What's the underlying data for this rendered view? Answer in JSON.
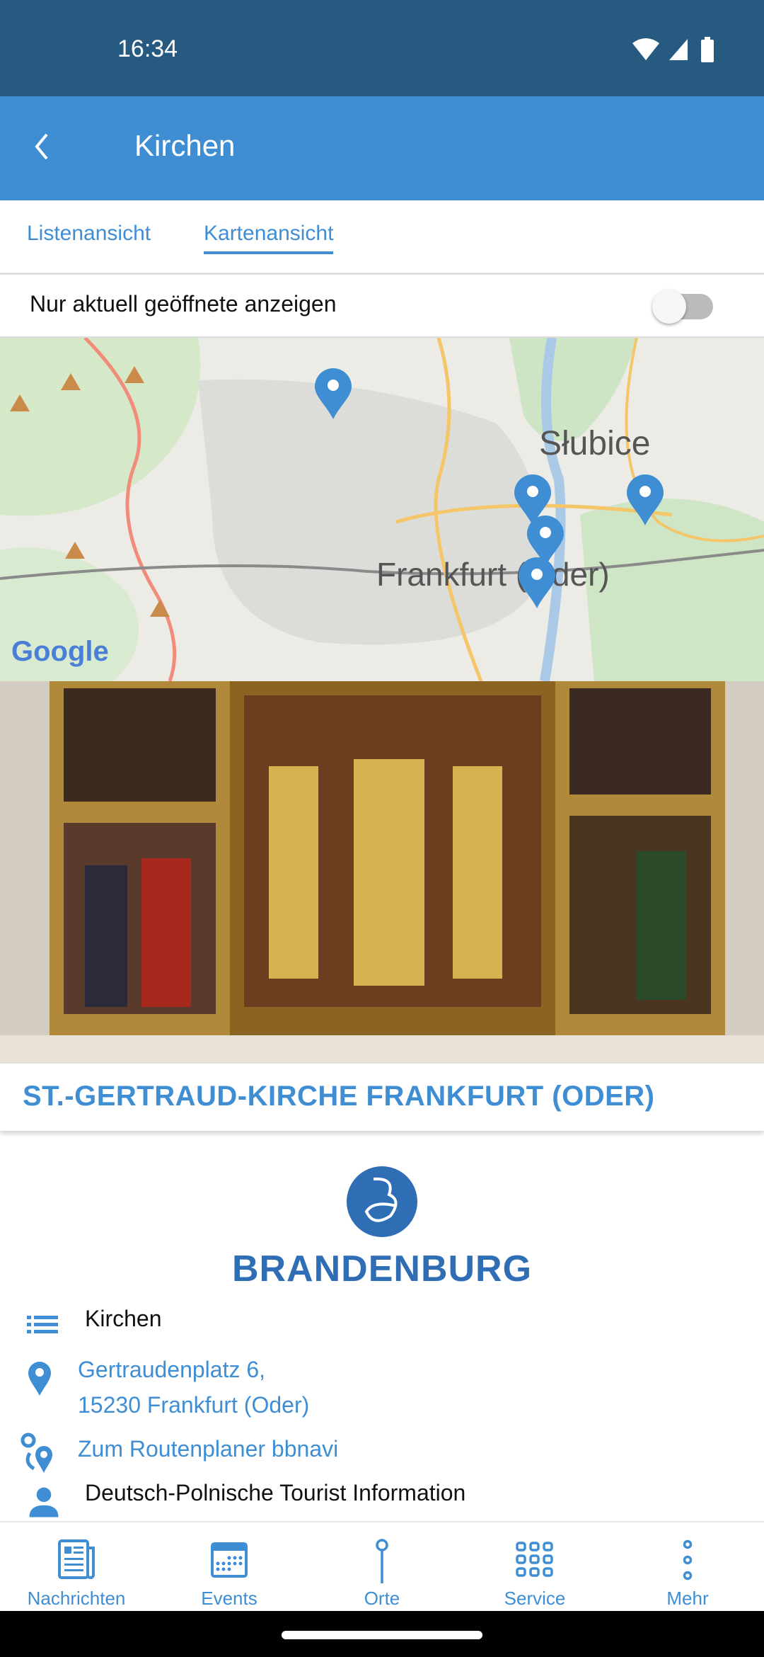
{
  "status_bar": {
    "time": "16:34",
    "icons": [
      "wifi-icon",
      "signal-icon",
      "battery-icon"
    ]
  },
  "app_bar": {
    "title": "Kirchen",
    "back_icon": "chevron-left-icon"
  },
  "tabs": [
    {
      "label": "Listenansicht",
      "active": false
    },
    {
      "label": "Kartenansicht",
      "active": true
    }
  ],
  "filter": {
    "label": "Nur aktuell geöffnete anzeigen",
    "enabled": false
  },
  "map": {
    "labels": {
      "city1": "Słubice",
      "city2": "Frankfurt (Oder)"
    },
    "attribution": "Google",
    "pin_count": 5
  },
  "detail": {
    "title": "ST.-GERTRAUD-KIRCHE FRANKFURT (ODER)",
    "logo_text": "BRANDENBURG",
    "category": "Kirchen",
    "address_line1": "Gertraudenplatz 6,",
    "address_line2": "15230 Frankfurt (Oder)",
    "route_link": "Zum Routenplaner bbnavi",
    "contact": "Deutsch-Polnische Tourist Information"
  },
  "bottom_nav": [
    {
      "label": "Nachrichten"
    },
    {
      "label": "Events"
    },
    {
      "label": "Orte"
    },
    {
      "label": "Service"
    },
    {
      "label": "Mehr"
    }
  ],
  "colors": {
    "primary": "#3f8ed4",
    "status_bar": "#265a80"
  }
}
